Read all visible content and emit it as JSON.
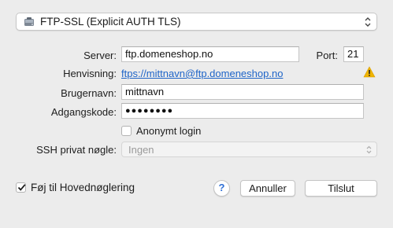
{
  "protocol": {
    "icon": "ftp-ssl-drive-icon",
    "label": "FTP-SSL (Explicit AUTH TLS)"
  },
  "server": {
    "label": "Server:",
    "value": "ftp.domeneshop.no"
  },
  "port": {
    "label": "Port:",
    "value": "21"
  },
  "reference": {
    "label": "Henvisning:",
    "link": "ftps://mittnavn@ftp.domeneshop.no",
    "warning_icon": "warning-triangle-icon",
    "warning_color": "#f0b400"
  },
  "username": {
    "label": "Brugernavn:",
    "value": "mittnavn"
  },
  "password": {
    "label": "Adgangskode:",
    "value": "●●●●●●●●"
  },
  "anonymous": {
    "label": "Anonymt login",
    "checked": false
  },
  "ssh_key": {
    "label": "SSH privat nøgle:",
    "value": "Ingen",
    "disabled": true
  },
  "keychain": {
    "label": "Føj til Hovednøglering",
    "checked": true
  },
  "help_button": {
    "label": "?"
  },
  "cancel_button": {
    "label": "Annuller"
  },
  "connect_button": {
    "label": "Tilslut"
  },
  "colors": {
    "accent": "#1e64c8",
    "background": "#ececec"
  }
}
